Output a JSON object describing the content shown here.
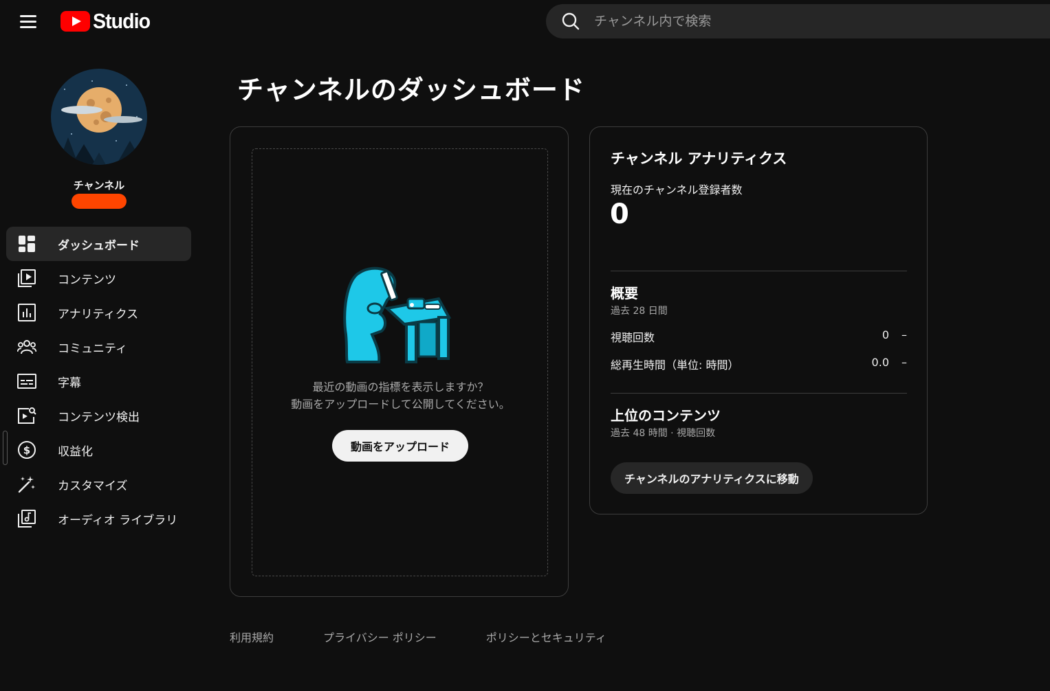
{
  "header": {
    "logo_text": "Studio",
    "search_placeholder": "チャンネル内で検索"
  },
  "sidebar": {
    "channel_label": "チャンネル",
    "items": [
      {
        "label": "ダッシュボード",
        "icon": "dashboard-icon",
        "active": true
      },
      {
        "label": "コンテンツ",
        "icon": "content-icon"
      },
      {
        "label": "アナリティクス",
        "icon": "analytics-icon"
      },
      {
        "label": "コミュニティ",
        "icon": "community-icon"
      },
      {
        "label": "字幕",
        "icon": "subtitles-icon"
      },
      {
        "label": "コンテンツ検出",
        "icon": "content-detection-icon"
      },
      {
        "label": "収益化",
        "icon": "monetization-icon"
      },
      {
        "label": "カスタマイズ",
        "icon": "customize-icon"
      },
      {
        "label": "オーディオ ライブラリ",
        "icon": "audio-library-icon"
      }
    ]
  },
  "main": {
    "title": "チャンネルのダッシュボード",
    "upload_card": {
      "message_line1": "最近の動画の指標を表示しますか？",
      "message_line2": "動画をアップロードして公開してください。",
      "button_label": "動画をアップロード"
    },
    "analytics_card": {
      "title": "チャンネル アナリティクス",
      "subscribers_label": "現在のチャンネル登録者数",
      "subscribers_value": "0",
      "summary_title": "概要",
      "summary_period": "過去 28 日間",
      "metrics": [
        {
          "label": "視聴回数",
          "value": "0",
          "trend": "–"
        },
        {
          "label": "総再生時間（単位: 時間）",
          "value": "0.0",
          "trend": "–"
        }
      ],
      "top_content_title": "上位のコンテンツ",
      "top_content_period": "過去 48 時間 · 視聴回数",
      "button_label": "チャンネルのアナリティクスに移動"
    }
  },
  "footer": {
    "links": [
      "利用規約",
      "プライバシー ポリシー",
      "ポリシーとセキュリティ"
    ]
  },
  "colors": {
    "background": "#0f0f0f",
    "brand_red": "#ff0000",
    "channel_name_redaction": "#ff4500",
    "illustration_cyan": "#1ec8e8"
  }
}
